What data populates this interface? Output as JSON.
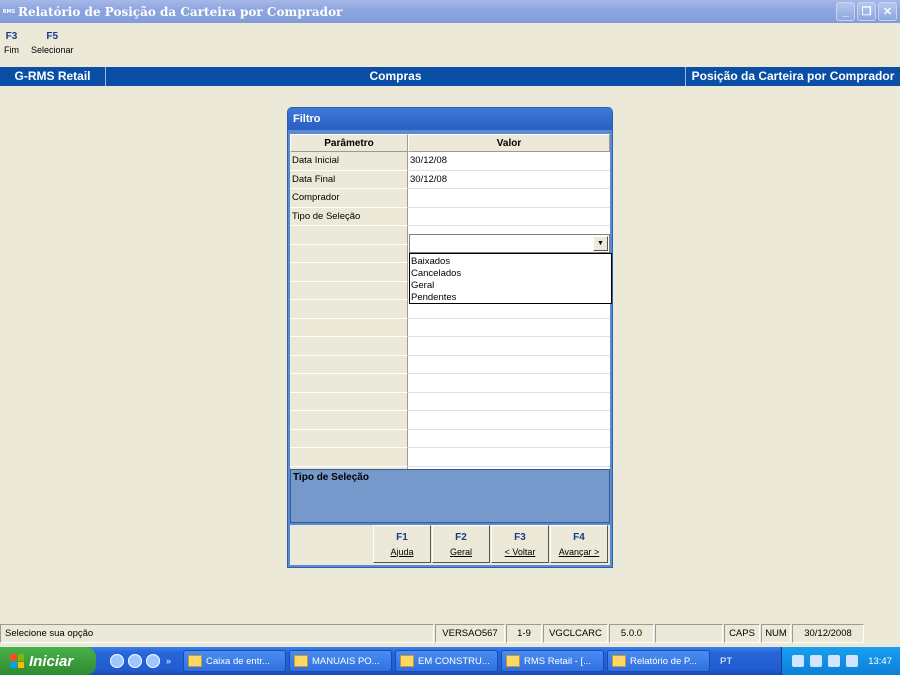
{
  "window": {
    "title": "Relatório de Posição da Carteira por Comprador",
    "icon_text": "RMS"
  },
  "fkeys": [
    {
      "key": "F3",
      "label": "Fim"
    },
    {
      "key": "F5",
      "label": "Selecionar"
    }
  ],
  "header": {
    "left": "G-RMS Retail",
    "center": "Compras",
    "right": "Posição da Carteira por Comprador"
  },
  "dialog": {
    "title": "Filtro",
    "col_param": "Parâmetro",
    "col_value": "Valor",
    "rows": [
      {
        "param": "Data Inicial",
        "value": "30/12/08"
      },
      {
        "param": "Data Final",
        "value": "30/12/08"
      },
      {
        "param": "Comprador",
        "value": ""
      },
      {
        "param": "Tipo de Seleção",
        "value": ""
      }
    ],
    "dropdown_options": [
      "Baixados",
      "Cancelados",
      "Geral",
      "Pendentes"
    ],
    "description": "Tipo de Seleção",
    "buttons": [
      {
        "key": "F1",
        "label": "Ajuda"
      },
      {
        "key": "F2",
        "label": "Geral"
      },
      {
        "key": "F3",
        "label": "< Voltar"
      },
      {
        "key": "F4",
        "label": "Avançar >"
      }
    ]
  },
  "statusbar": {
    "message": "Selecione sua opção",
    "version": "VERSAO567",
    "range": "1-9",
    "program": "VGCLCARC",
    "release": "5.0.0",
    "caps": "CAPS",
    "num": "NUM",
    "date": "30/12/2008"
  },
  "taskbar": {
    "start_label": "Iniciar",
    "tasks": [
      "Caixa de entr...",
      "MANUAIS PO...",
      "EM CONSTRU...",
      "RMS Retail - [...",
      "Relatório de P..."
    ],
    "language": "PT",
    "clock": "13:47"
  }
}
